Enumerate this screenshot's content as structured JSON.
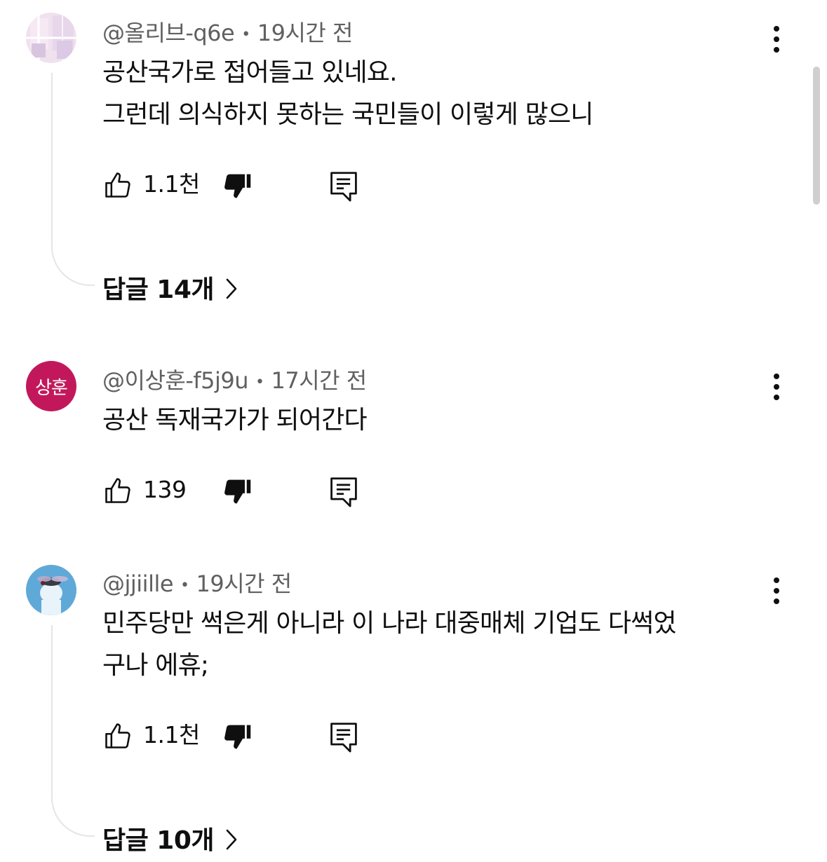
{
  "comments": [
    {
      "author": "@올리브-q6e",
      "time": "19시간 전",
      "lines": [
        "공산국가로 접어들고 있네요.",
        "그런데 의식하지 못하는 국민들이 이렇게 많으니"
      ],
      "likes": "1.1천",
      "replies_label": "답글 14개"
    },
    {
      "author": "@이상훈-f5j9u",
      "time": "17시간 전",
      "avatar_initials": "상훈",
      "avatar_color": "#c2185b",
      "lines": [
        "공산 독재국가가 되어간다"
      ],
      "likes": "139"
    },
    {
      "author": "@jjiille",
      "time": "19시간 전",
      "lines": [
        "민주당만 썩은게 아니라 이 나라 대중매체 기업도 다썩었",
        "구나 에휴;"
      ],
      "likes": "1.1천",
      "replies_label": "답글 10개"
    }
  ],
  "icons": {
    "like": "thumbs-up-icon",
    "dislike": "thumbs-down-icon",
    "reply": "reply-comment-icon",
    "more": "more-vertical-icon",
    "chevron": "chevron-right-icon"
  },
  "separator": "•"
}
